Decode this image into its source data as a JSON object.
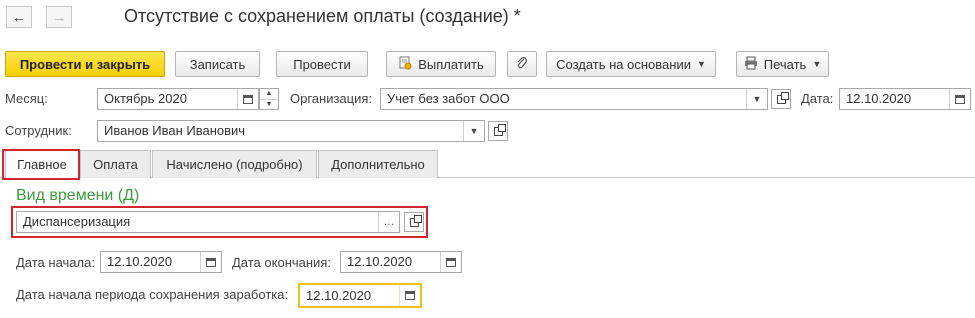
{
  "window": {
    "title": "Отсутствие с сохранением оплаты (создание) *"
  },
  "nav": {
    "back_icon": "←",
    "forward_icon": "→"
  },
  "toolbar": {
    "post_close": "Провести и закрыть",
    "save": "Записать",
    "post": "Провести",
    "pay": "Выплатить",
    "create_based": "Создать на основании",
    "print": "Печать"
  },
  "header": {
    "month_label": "Месяц:",
    "month_value": "Октябрь 2020",
    "org_label": "Организация:",
    "org_value": "Учет без забот ООО",
    "date_label": "Дата:",
    "date_value": "12.10.2020",
    "employee_label": "Сотрудник:",
    "employee_value": "Иванов Иван Иванович"
  },
  "tabs": [
    {
      "label": "Главное"
    },
    {
      "label": "Оплата"
    },
    {
      "label": "Начислено (подробно)"
    },
    {
      "label": "Дополнительно"
    }
  ],
  "main": {
    "time_type_heading": "Вид времени (Д)",
    "time_type_value": "Диспансеризация",
    "start_label": "Дата начала:",
    "start_value": "12.10.2020",
    "end_label": "Дата окончания:",
    "end_value": "12.10.2020",
    "period_start_label": "Дата начала периода сохранения заработка:",
    "period_start_value": "12.10.2020"
  },
  "colors": {
    "accent_yellow": "#f4cf06",
    "highlight_red": "#d3262e",
    "group_green": "#3d9a3d"
  }
}
